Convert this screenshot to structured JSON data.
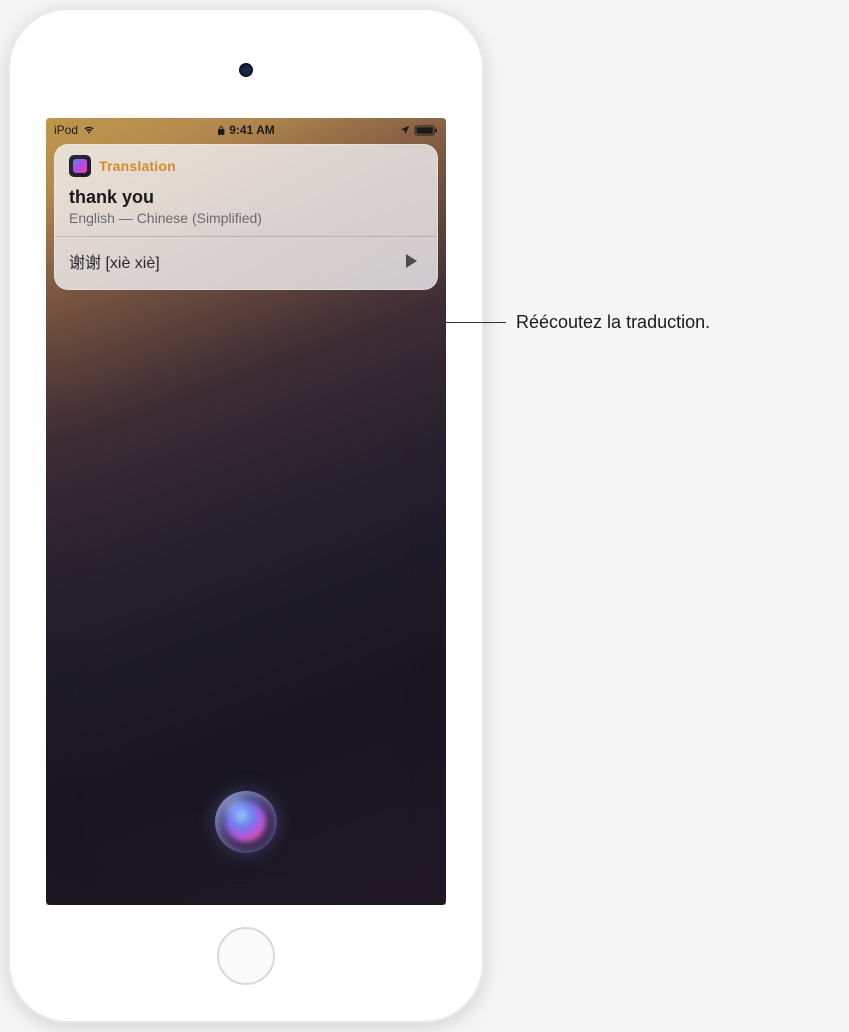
{
  "statusBar": {
    "carrier": "iPod",
    "time": "9:41 AM"
  },
  "card": {
    "appTitle": "Translation",
    "appTitleColor": "#d88a2a",
    "sourceText": "thank you",
    "languagePair": "English — Chinese (Simplified)",
    "translatedText": "谢谢 [xiè xiè]"
  },
  "callout": {
    "text": "Réécoutez la traduction."
  }
}
